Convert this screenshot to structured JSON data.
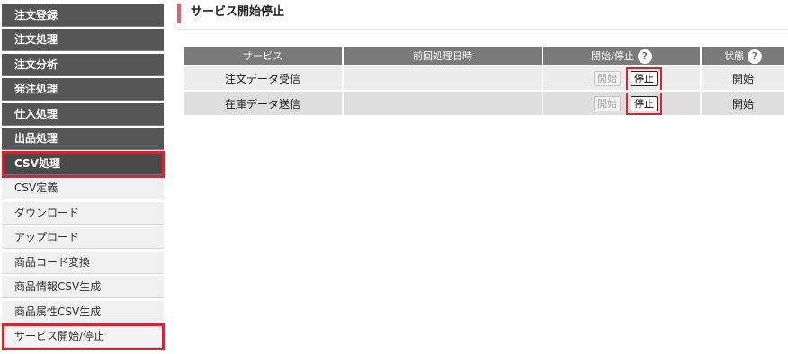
{
  "sidebar": {
    "primary": [
      {
        "label": "注文登録"
      },
      {
        "label": "注文処理"
      },
      {
        "label": "注文分析"
      },
      {
        "label": "発注処理"
      },
      {
        "label": "仕入処理"
      },
      {
        "label": "出品処理"
      },
      {
        "label": "CSV処理"
      }
    ],
    "sub": [
      {
        "label": "CSV定義"
      },
      {
        "label": "ダウンロード"
      },
      {
        "label": "アップロード"
      },
      {
        "label": "商品コード変換"
      },
      {
        "label": "商品情報CSV生成"
      },
      {
        "label": "商品属性CSV生成"
      },
      {
        "label": "サービス開始/停止"
      }
    ]
  },
  "page": {
    "title": "サービス開始停止"
  },
  "table": {
    "headers": {
      "service": "サービス",
      "last_run": "前回処理日時",
      "start_stop": "開始/停止",
      "status": "状態",
      "help_glyph": "?"
    },
    "rows": [
      {
        "service": "注文データ受信",
        "last_run": "",
        "start_label": "開始",
        "stop_label": "停止",
        "status": "開始"
      },
      {
        "service": "在庫データ送信",
        "last_run": "",
        "start_label": "開始",
        "stop_label": "停止",
        "status": "開始"
      }
    ]
  },
  "colors": {
    "highlight": "#d9232f",
    "nav_dark": "#565656",
    "table_header": "#7a7a7a",
    "title_accent": "#e06168"
  }
}
